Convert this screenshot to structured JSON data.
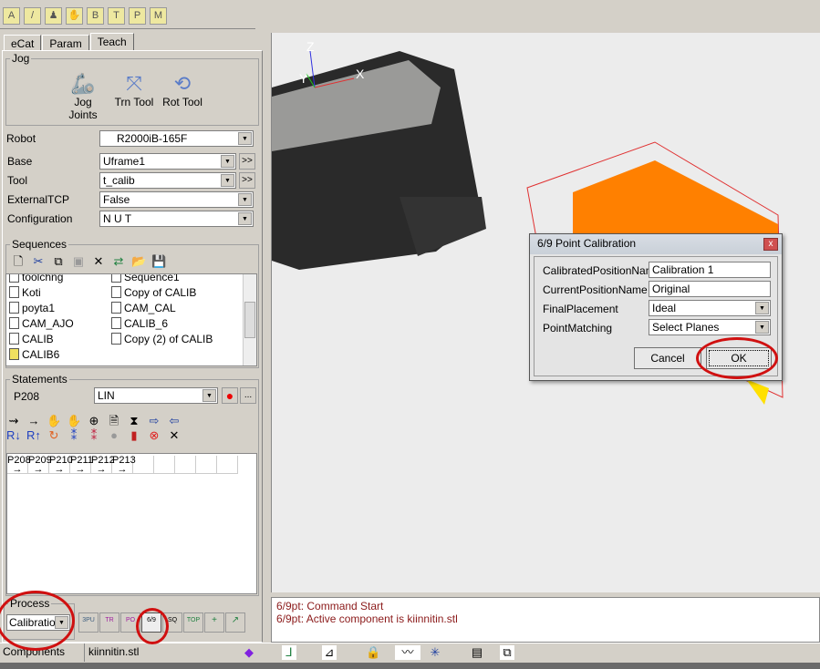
{
  "toolbar": {
    "icons": [
      "a-icon",
      "pencil-icon",
      "users-icon",
      "hand-icon",
      "b-icon",
      "t-icon",
      "p-icon",
      "m-icon"
    ],
    "glyphs": [
      "A",
      "/",
      "♟",
      "✋",
      "B",
      "T",
      "P",
      "M"
    ]
  },
  "tabs": [
    "eCat",
    "Param",
    "Teach"
  ],
  "jog": {
    "title": "Jog",
    "buttons": [
      "Jog Joints",
      "Trn Tool",
      "Rot Tool"
    ]
  },
  "form": {
    "robot_label": "Robot",
    "robot": "R2000iB-165F",
    "base_label": "Base",
    "base": "Uframe1",
    "tool_label": "Tool",
    "tool": "t_calib",
    "ext_label": "ExternalTCP",
    "ext": "False",
    "config_label": "Configuration",
    "config": "N U T",
    "more": ">>"
  },
  "sequences": {
    "title": "Sequences",
    "items": [
      "toolchng",
      "Koti",
      "poyta1",
      "CAM_AJO",
      "CALIB",
      "CALIB6",
      "Sequence1",
      "Copy of CALIB",
      "CAM_CAL",
      "CALIB_6",
      "Copy (2) of CALIB"
    ]
  },
  "statements": {
    "title": "Statements",
    "point": "P208",
    "motion": "LIN",
    "more": "...",
    "points": [
      "P208",
      "P209",
      "P210",
      "P211",
      "P212",
      "P213"
    ]
  },
  "process": {
    "title": "Process",
    "value": "Calibration",
    "buttons": [
      "3PU",
      "TR",
      "PO",
      "6/9",
      "SQ",
      "TOP",
      "+",
      "↗"
    ]
  },
  "log": [
    "6/9pt: Command Start",
    "6/9pt: Active component is kiinnitin.stl"
  ],
  "status": {
    "label": "Components",
    "value": "kiinnitin.stl"
  },
  "viewport": {
    "axes": {
      "x": "X",
      "y": "Y",
      "z": "Z"
    }
  },
  "dialog": {
    "title": "6/9 Point Calibration",
    "close": "x",
    "rows": [
      {
        "label": "CalibratedPositionName",
        "value": "Calibration 1"
      },
      {
        "label": "CurrentPositionName",
        "value": "Original"
      },
      {
        "label": "FinalPlacement",
        "value": "Ideal"
      },
      {
        "label": "PointMatching",
        "value": "Select Planes"
      }
    ],
    "cancel": "Cancel",
    "ok": "OK"
  },
  "colors": {
    "annotation": "#d01010",
    "part": "#ff8000",
    "log_text": "#8b1a1a"
  }
}
